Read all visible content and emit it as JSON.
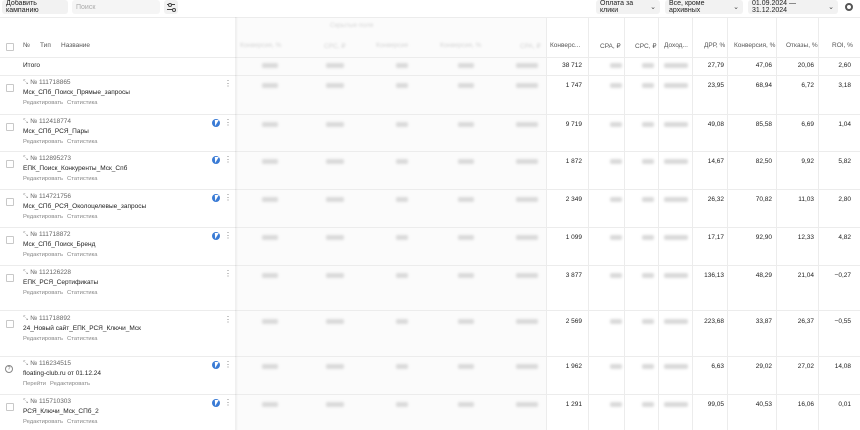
{
  "toolbar": {
    "add_campaign": "Добавить кампанию",
    "search_placeholder": "Поиск",
    "payment_filter": "Оплата за клики",
    "archive_filter": "Все, кроме архивных",
    "date_range": "01.09.2024 — 31.12.2024"
  },
  "table": {
    "headers": {
      "num": "№",
      "type": "Тип",
      "name": "Название",
      "conversions": "Конверс...",
      "cpa": "CPA, ₽",
      "cpc": "CPC, ₽",
      "income": "Доход...",
      "drr": "ДРР, %",
      "conversion_rate": "Конверсия, %",
      "bounces": "Отказы, %",
      "roi": "ROI, %"
    },
    "total": {
      "label": "Итого",
      "conversions": "38 712",
      "drr": "27,79",
      "conversion_rate": "47,06",
      "bounces": "20,06",
      "roi": "2,60"
    },
    "rows": [
      {
        "id": "№ 111718865",
        "name": "Мск_СПб_Поиск_Прямые_запросы",
        "links": [
          "Редактировать",
          "Статистика"
        ],
        "conversions": "1 747",
        "drr": "23,95",
        "conversion_rate": "68,94",
        "bounces": "6,72",
        "roi": "3,18"
      },
      {
        "id": "№ 112418774",
        "name": "Мск_СПб_РСЯ_Пары",
        "links": [
          "Редактировать",
          "Статистика"
        ],
        "conversions": "9 719",
        "drr": "49,08",
        "conversion_rate": "85,58",
        "bounces": "6,69",
        "roi": "1,04"
      },
      {
        "id": "№ 112895273",
        "name": "ЕПК_Поиск_Конкуренты_Мск_Спб",
        "links": [
          "Редактировать",
          "Статистика"
        ],
        "conversions": "1 872",
        "drr": "14,67",
        "conversion_rate": "82,50",
        "bounces": "9,92",
        "roi": "5,82"
      },
      {
        "id": "№ 114721756",
        "name": "Мск_СПб_РСЯ_Околоцелевые_запросы",
        "links": [
          "Редактировать",
          "Статистика"
        ],
        "conversions": "2 349",
        "drr": "26,32",
        "conversion_rate": "70,82",
        "bounces": "11,03",
        "roi": "2,80"
      },
      {
        "id": "№ 111718872",
        "name": "Мск_СПб_Поиск_Бренд",
        "links": [
          "Редактировать",
          "Статистика"
        ],
        "conversions": "1 099",
        "drr": "17,17",
        "conversion_rate": "92,90",
        "bounces": "12,33",
        "roi": "4,82"
      },
      {
        "id": "№ 112126228",
        "name": "ЕПК_РСЯ_Сертификаты",
        "links": [
          "Редактировать",
          "Статистика"
        ],
        "conversions": "3 877",
        "drr": "136,13",
        "conversion_rate": "48,29",
        "bounces": "21,04",
        "roi": "−0,27"
      },
      {
        "id": "№ 111718892",
        "name": "24_Новый сайт_ЕПК_РСЯ_Ключи_Мск",
        "links": [
          "Редактировать",
          "Статистика"
        ],
        "conversions": "2 569",
        "drr": "223,68",
        "conversion_rate": "33,87",
        "bounces": "26,37",
        "roi": "−0,55"
      },
      {
        "id": "№ 116234515",
        "name": "floating-club.ru от 01.12.24",
        "links": [
          "Перейти",
          "Редактировать"
        ],
        "conversions": "1 962",
        "drr": "6,63",
        "conversion_rate": "29,02",
        "bounces": "27,02",
        "roi": "14,08"
      },
      {
        "id": "№ 115710303",
        "name": "РСЯ_Ключи_Мск_СПб_2",
        "links": [
          "Редактировать",
          "Статистика"
        ],
        "conversions": "1 291",
        "drr": "99,05",
        "conversion_rate": "40,53",
        "bounces": "16,06",
        "roi": "0,01"
      }
    ]
  },
  "icons": [
    "sliders-icon",
    "chevron-down-icon",
    "gear-icon",
    "autotarget-bolt-icon",
    "more-vertical-icon",
    "help-circle-icon",
    "link-icon"
  ],
  "colors": {
    "bolt": "#3a7bd5",
    "grid": "#ececec"
  }
}
